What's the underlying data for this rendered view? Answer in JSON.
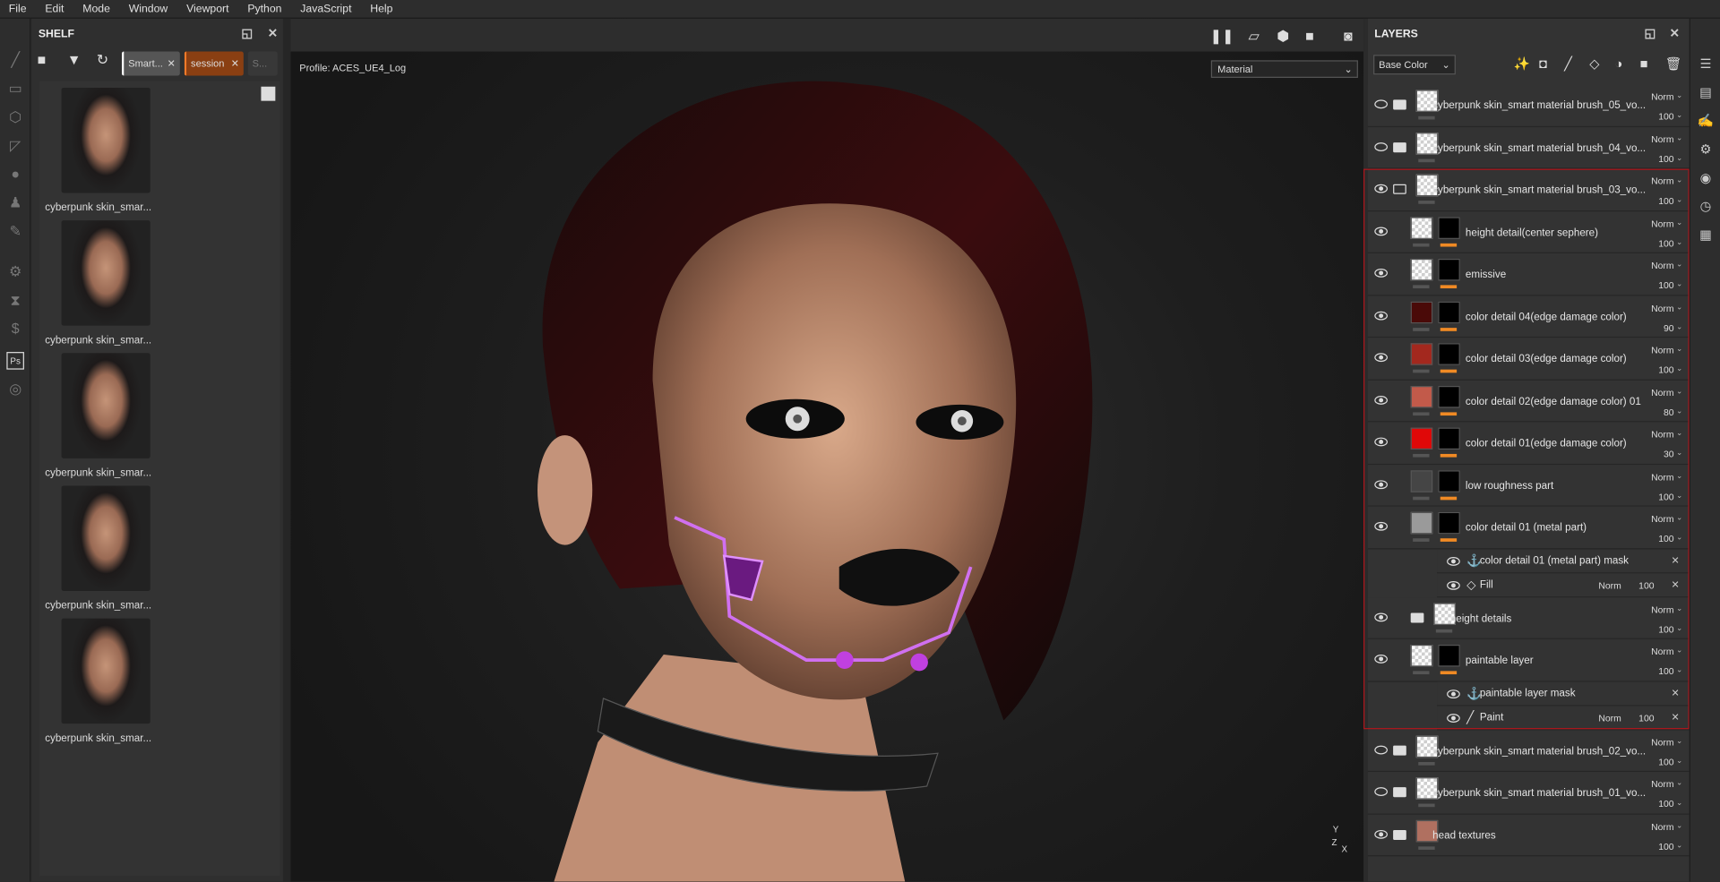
{
  "menu": [
    "File",
    "Edit",
    "Mode",
    "Window",
    "Viewport",
    "Python",
    "JavaScript",
    "Help"
  ],
  "left_tools": [
    "brush-icon",
    "eraser-icon",
    "projection-icon",
    "select-icon",
    "smudge-icon",
    "clone-stamp-icon",
    "eyedropper-icon",
    "substance-icon",
    "hourglass-icon",
    "substance-s-icon",
    "photoshop-icon",
    "sync-icon"
  ],
  "shelf": {
    "title": "SHELF",
    "chips": [
      {
        "label": "Smart...",
        "color": "#555555"
      },
      {
        "label": "session",
        "color": "#8a3f12"
      },
      {
        "label": "S..."
      }
    ],
    "items": [
      {
        "label": "cyberpunk skin_smar..."
      },
      {
        "label": "cyberpunk skin_smar..."
      },
      {
        "label": "cyberpunk skin_smar..."
      },
      {
        "label": "cyberpunk skin_smar..."
      },
      {
        "label": "cyberpunk skin_smar..."
      }
    ]
  },
  "viewport": {
    "profile": "Profile: ACES_UE4_Log",
    "channel": "Material",
    "axis": {
      "y": "Y",
      "z": "Z",
      "x": "X"
    }
  },
  "layers": {
    "title": "LAYERS",
    "channel": "Base Color",
    "highlight_color": "#b0161c",
    "rows": [
      {
        "name": "cyberpunk skin_smart material brush_05_vo...",
        "kind": "group",
        "visible": false,
        "blend": "Norm",
        "opacity": "100"
      },
      {
        "name": "cyberpunk skin_smart material brush_04_vo...",
        "kind": "group",
        "visible": false,
        "blend": "Norm",
        "opacity": "100"
      },
      {
        "name": "cyberpunk skin_smart material brush_03_vo...",
        "kind": "group",
        "open": true,
        "visible": true,
        "blend": "Norm",
        "opacity": "100"
      },
      {
        "name": "height detail(center sephere)",
        "kind": "layer",
        "thumb": "checker",
        "mask": true,
        "visible": true,
        "blend": "Norm",
        "opacity": "100"
      },
      {
        "name": "emissive",
        "kind": "layer",
        "thumb": "checker",
        "mask": true,
        "visible": true,
        "blend": "Norm",
        "opacity": "100"
      },
      {
        "name": "color detail 04(edge damage color)",
        "kind": "layer",
        "thumb": "#4a0a08",
        "mask": true,
        "visible": true,
        "blend": "Norm",
        "opacity": "90"
      },
      {
        "name": "color detail 03(edge damage color)",
        "kind": "layer",
        "thumb": "#a3281e",
        "mask": true,
        "visible": true,
        "blend": "Norm",
        "opacity": "100"
      },
      {
        "name": "color detail 02(edge damage color) 01",
        "kind": "layer",
        "thumb": "#c25a4a",
        "mask": true,
        "visible": true,
        "blend": "Norm",
        "opacity": "80"
      },
      {
        "name": "color detail 01(edge damage color)",
        "kind": "layer",
        "thumb": "#e00808",
        "mask": true,
        "visible": true,
        "blend": "Norm",
        "opacity": "30"
      },
      {
        "name": "low roughness part",
        "kind": "layer",
        "thumb": "#454545",
        "mask": true,
        "visible": true,
        "blend": "Norm",
        "opacity": "100"
      },
      {
        "name": "color detail 01 (metal part)",
        "kind": "layer",
        "thumb": "#9a9a9a",
        "mask": true,
        "visible": true,
        "blend": "Norm",
        "opacity": "100"
      },
      {
        "name": "color detail 01 (metal part) mask",
        "kind": "sub",
        "icon": "anchor-icon",
        "visible": true
      },
      {
        "name": "Fill",
        "kind": "sub",
        "icon": "fill-bucket-icon",
        "visible": true,
        "blend": "Norm",
        "opacity": "100"
      },
      {
        "name": "height details",
        "kind": "subgroup",
        "visible": true,
        "blend": "Norm",
        "opacity": "100"
      },
      {
        "name": "paintable layer",
        "kind": "layer",
        "thumb": "checker",
        "mask": true,
        "visible": true,
        "blend": "Norm",
        "opacity": "100"
      },
      {
        "name": "paintable layer mask",
        "kind": "sub",
        "icon": "anchor-icon",
        "visible": true
      },
      {
        "name": "Paint",
        "kind": "sub",
        "icon": "paint-brush-icon",
        "visible": true,
        "blend": "Norm",
        "opacity": "100"
      },
      {
        "name": "cyberpunk skin_smart material brush_02_vo...",
        "kind": "group",
        "visible": false,
        "blend": "Norm",
        "opacity": "100"
      },
      {
        "name": "cyberpunk skin_smart material brush_01_vo...",
        "kind": "group",
        "visible": false,
        "blend": "Norm",
        "opacity": "100"
      },
      {
        "name": "head textures",
        "kind": "group",
        "thumb": "#b07060",
        "visible": true,
        "blend": "Norm",
        "opacity": "100"
      }
    ]
  },
  "right_tools": [
    "layers-list-icon",
    "texture-settings-icon",
    "brush-settings-icon",
    "display-settings-icon",
    "shader-settings-icon",
    "history-icon",
    "log-icon"
  ]
}
